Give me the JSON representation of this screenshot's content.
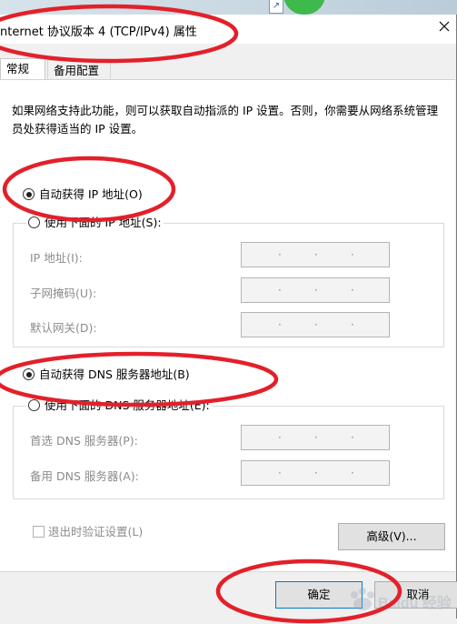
{
  "window": {
    "title": "nternet 协议版本 4 (TCP/IPv4) 属性"
  },
  "tabs": [
    {
      "label": "常规",
      "active": true
    },
    {
      "label": "备用配置",
      "active": false
    }
  ],
  "description": "如果网络支持此功能，则可以获取自动指派的 IP 设置。否则，你需要从网络系统管理员处获得适当的 IP 设置。",
  "ip": {
    "auto_label": "自动获得 IP 地址(O)",
    "auto_checked": true,
    "manual_label": "使用下面的 IP 地址(S):",
    "manual_checked": false,
    "fields": [
      {
        "label": "IP 地址(I):",
        "value": ". . ."
      },
      {
        "label": "子网掩码(U):",
        "value": ". . ."
      },
      {
        "label": "默认网关(D):",
        "value": ". . ."
      }
    ]
  },
  "dns": {
    "auto_label": "自动获得 DNS 服务器地址(B)",
    "auto_checked": true,
    "manual_label": "使用下面的 DNS 服务器地址(E):",
    "manual_checked": false,
    "fields": [
      {
        "label": "首选 DNS 服务器(P):",
        "value": ". . ."
      },
      {
        "label": "备用 DNS 服务器(A):",
        "value": ". . ."
      }
    ]
  },
  "validate_on_exit": {
    "label": "退出时验证设置(L)",
    "checked": false
  },
  "buttons": {
    "advanced": "高级(V)...",
    "ok": "确定",
    "cancel": "取消"
  },
  "watermark": "Baidu 经验",
  "colors": {
    "annotation_red": "#e3202a",
    "disabled_text": "#8c8c8c",
    "focus_blue": "#0078d7"
  }
}
